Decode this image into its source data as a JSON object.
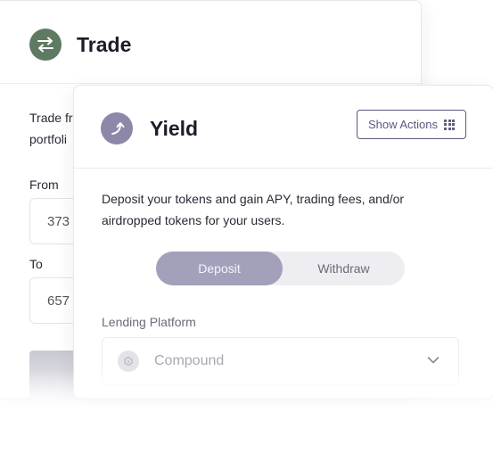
{
  "trade": {
    "title": "Trade",
    "description": "Trade fr\nportfoli",
    "from_label": "From",
    "from_value": "373",
    "to_label": "To",
    "to_value": "657"
  },
  "yield": {
    "title": "Yield",
    "show_actions_label": "Show Actions",
    "description": "Deposit your tokens and gain APY, trading fees, and/or\nairdropped tokens for your users.",
    "toggle": {
      "deposit": "Deposit",
      "withdraw": "Withdraw",
      "selected": "Deposit"
    },
    "lending_label": "Lending Platform",
    "lending_value": "Compound"
  },
  "colors": {
    "trade_icon_bg": "#5f7a62",
    "yield_icon_bg": "#8d87a8",
    "accent": "#5e5880",
    "toggle_active": "#a3a0bb"
  },
  "icons": {
    "trade": "swap-arrows-icon",
    "yield": "curved-arrow-up-icon",
    "actions": "grid-icon",
    "platform": "compound-icon",
    "dropdown": "chevron-down-icon"
  }
}
